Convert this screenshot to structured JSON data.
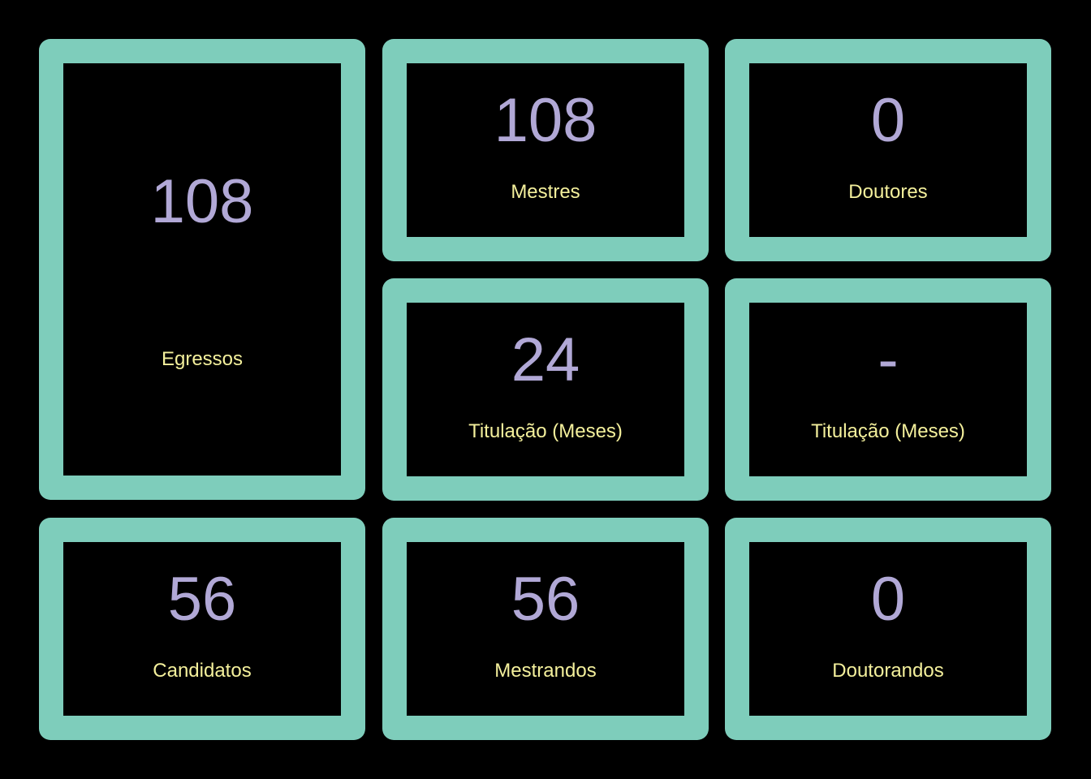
{
  "colors": {
    "background": "#000000",
    "card_border": "#7ecdbb",
    "value_text": "#b1a8d6",
    "label_text": "#f4f09c"
  },
  "cards": {
    "egressos": {
      "value": "108",
      "label": "Egressos"
    },
    "mestres": {
      "value": "108",
      "label": "Mestres"
    },
    "doutores": {
      "value": "0",
      "label": "Doutores"
    },
    "titulacao_mestrado": {
      "value": "24",
      "label": "Titulação (Meses)"
    },
    "titulacao_doutorado": {
      "value": "-",
      "label": "Titulação (Meses)"
    },
    "candidatos": {
      "value": "56",
      "label": "Candidatos"
    },
    "mestrandos": {
      "value": "56",
      "label": "Mestrandos"
    },
    "doutorandos": {
      "value": "0",
      "label": "Doutorandos"
    }
  }
}
